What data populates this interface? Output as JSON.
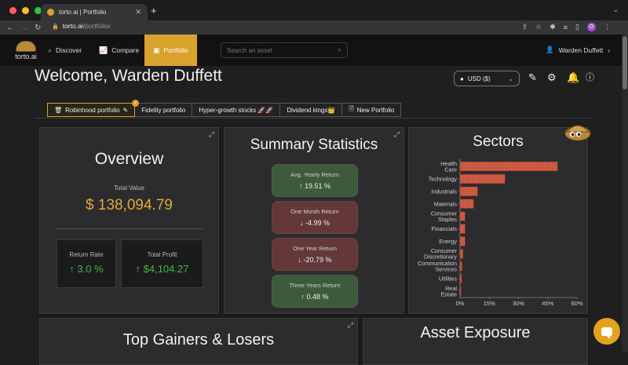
{
  "browser": {
    "tab_title": "torto.ai | Portfolio",
    "url_host": "torto.ai",
    "url_path": "/portfolio/",
    "profile_initial": "O"
  },
  "nav": {
    "logo_text": "torto.ai",
    "items": [
      {
        "label": "Discover",
        "icon": "search-icon"
      },
      {
        "label": "Compare",
        "icon": "chart-icon"
      },
      {
        "label": "Portfolio",
        "icon": "briefcase-icon",
        "active": true
      }
    ],
    "search_placeholder": "Search an asset",
    "user_name": "Warden Duffett"
  },
  "header": {
    "welcome": "Welcome, Warden Duffett",
    "currency": "USD ($)"
  },
  "portfolio_tabs": [
    {
      "label": "Robinhood portfolio",
      "active": true
    },
    {
      "label": "Fidelity portfolio"
    },
    {
      "label": "Hyper-growth stocks 🚀🚀"
    },
    {
      "label": "Dividend kings👑"
    },
    {
      "label": "New Portfolio"
    }
  ],
  "overview": {
    "title": "Overview",
    "total_value_label": "Total Value",
    "total_value": "$ 138,094.79",
    "return_rate_label": "Return Rate",
    "return_rate": "↑ 3.0 %",
    "total_profit_label": "Total Profit",
    "total_profit": "↑ $4,104.27"
  },
  "summary": {
    "title": "Summary Statistics",
    "stats": [
      {
        "label": "Avg. Yearly Return",
        "value": "↑ 19.51 %",
        "trend": "positive"
      },
      {
        "label": "One Month Return",
        "value": "↓ -4.99 %",
        "trend": "negative"
      },
      {
        "label": "One Year Return",
        "value": "↓ -20.79 %",
        "trend": "negative"
      },
      {
        "label": "Three Years Return",
        "value": "↑ 0.48 %",
        "trend": "positive"
      }
    ]
  },
  "sectors": {
    "title": "Sectors"
  },
  "bottom": {
    "gainers_title": "Top Gainers & Losers",
    "exposure_title": "Asset Exposure"
  },
  "colors": {
    "accent": "#d9a22d",
    "positive": "#3fb54a",
    "bar_fill": "#c8553d"
  },
  "chart_data": {
    "type": "bar",
    "orientation": "horizontal",
    "categories": [
      [
        "Health",
        "Care"
      ],
      [
        "Technology"
      ],
      [
        "Industrials"
      ],
      [
        "Materials"
      ],
      [
        "Consumer",
        "Staples"
      ],
      [
        "Financials"
      ],
      [
        "Energy"
      ],
      [
        "Consumer",
        "Discretionary"
      ],
      [
        "Communication",
        "Services"
      ],
      [
        "Utilities"
      ],
      [
        "Real",
        "Estate"
      ]
    ],
    "values": [
      50,
      23,
      9,
      7,
      2.5,
      2.5,
      2.5,
      1.5,
      1,
      0.8,
      0.5
    ],
    "xlim": [
      0,
      60
    ],
    "xticks": [
      "0%",
      "15%",
      "30%",
      "45%",
      "60%"
    ],
    "xtick_values": [
      0,
      15,
      30,
      45,
      60
    ],
    "bar_color": "#c8553d"
  }
}
